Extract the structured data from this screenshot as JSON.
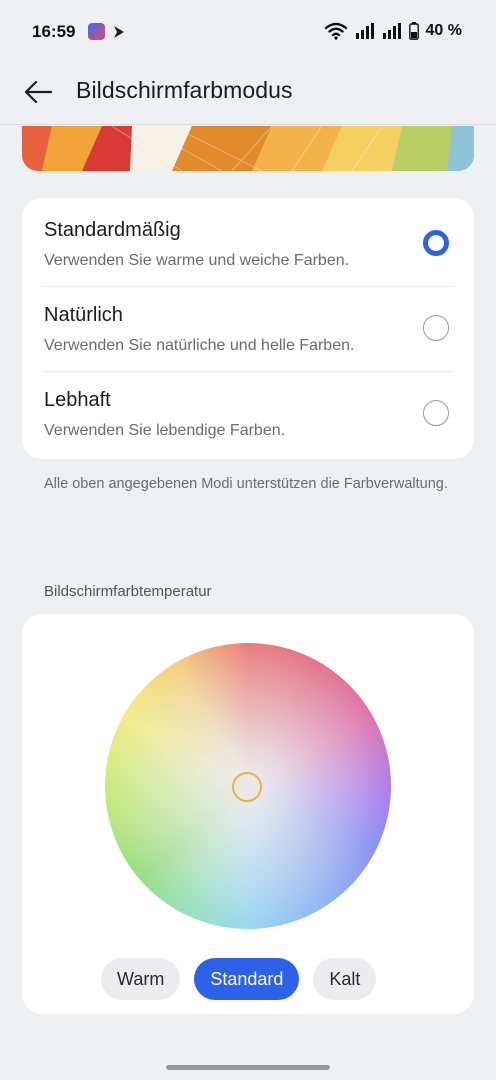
{
  "status_bar": {
    "time": "16:59",
    "battery": "40 %"
  },
  "header": {
    "title": "Bildschirmfarbmodus"
  },
  "modes": [
    {
      "title": "Standardmäßig",
      "description": "Verwenden Sie warme und weiche Farben.",
      "selected": true
    },
    {
      "title": "Natürlich",
      "description": "Verwenden Sie natürliche und helle Farben.",
      "selected": false
    },
    {
      "title": "Lebhaft",
      "description": "Verwenden Sie lebendige Farben.",
      "selected": false
    }
  ],
  "footnote": "Alle oben angegebenen Modi unterstützen die Farbverwaltung.",
  "temperature": {
    "section_label": "Bildschirmfarbtemperatur",
    "buttons": [
      {
        "label": "Warm",
        "active": false
      },
      {
        "label": "Standard",
        "active": true
      },
      {
        "label": "Kalt",
        "active": false
      }
    ]
  },
  "colors": {
    "accent": "#2d62e8",
    "background": "#eff0f3",
    "card": "#ffffff"
  }
}
